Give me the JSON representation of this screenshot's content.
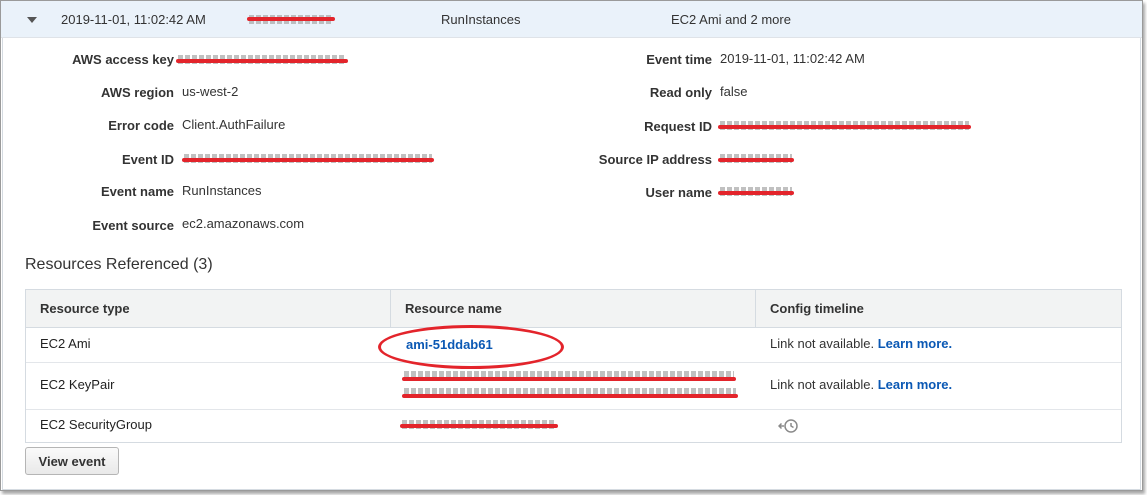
{
  "header": {
    "time": "2019-11-01, 11:02:42 AM",
    "event_name": "RunInstances",
    "resources_summary": "EC2 Ami and 2 more"
  },
  "details": {
    "left": [
      {
        "label": "AWS access key",
        "value": "",
        "redacted": true
      },
      {
        "label": "AWS region",
        "value": "us-west-2",
        "redacted": false
      },
      {
        "label": "Error code",
        "value": "Client.AuthFailure",
        "redacted": false
      },
      {
        "label": "Event ID",
        "value": "",
        "redacted": true
      },
      {
        "label": "Event name",
        "value": "RunInstances",
        "redacted": false
      },
      {
        "label": "Event source",
        "value": "ec2.amazonaws.com",
        "redacted": false
      }
    ],
    "right": [
      {
        "label": "Event time",
        "value": "2019-11-01, 11:02:42 AM",
        "redacted": false
      },
      {
        "label": "Read only",
        "value": "false",
        "redacted": false
      },
      {
        "label": "Request ID",
        "value": "",
        "redacted": true
      },
      {
        "label": "Source IP address",
        "value": "",
        "redacted": true
      },
      {
        "label": "User name",
        "value": "",
        "redacted": true
      }
    ]
  },
  "resources": {
    "title": "Resources Referenced (3)",
    "columns": [
      "Resource type",
      "Resource name",
      "Config timeline"
    ],
    "rows": [
      {
        "type": "EC2 Ami",
        "name": "ami-51ddab61",
        "name_redacted": false,
        "timeline_text": "Link not available.",
        "timeline_link": "Learn more.",
        "timeline_icon": null
      },
      {
        "type": "EC2 KeyPair",
        "name": "",
        "name_redacted": true,
        "timeline_text": "Link not available.",
        "timeline_link": "Learn more.",
        "timeline_icon": null
      },
      {
        "type": "EC2 SecurityGroup",
        "name": "",
        "name_redacted": true,
        "timeline_text": "",
        "timeline_link": "",
        "timeline_icon": "config-timeline-icon"
      }
    ]
  },
  "actions": {
    "view_event": "View event"
  },
  "colors": {
    "redaction": "#e3242b",
    "link": "#0a58b4",
    "header_bg": "#eaf2fa"
  }
}
